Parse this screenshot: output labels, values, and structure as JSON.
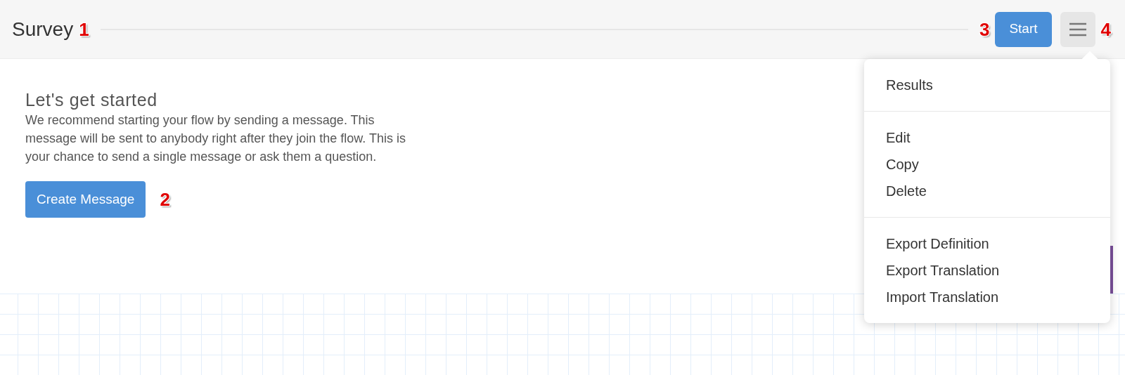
{
  "header": {
    "title": "Survey",
    "start_button": "Start"
  },
  "intro": {
    "heading": "Let's get started",
    "text": "We recommend starting your flow by sending a message. This message will be sent to anybody right after they join the flow. This is your chance to send a single message or ask them a question.",
    "button": "Create Message"
  },
  "menu": {
    "expanded": true,
    "groups": [
      [
        "Results"
      ],
      [
        "Edit",
        "Copy",
        "Delete"
      ],
      [
        "Export Definition",
        "Export Translation",
        "Import Translation"
      ]
    ]
  },
  "annotations": [
    "1",
    "2",
    "3",
    "4"
  ]
}
